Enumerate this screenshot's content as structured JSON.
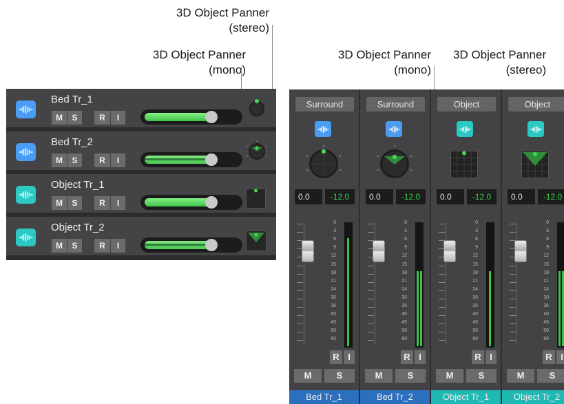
{
  "callouts": {
    "top_stereo": [
      "3D Object Panner",
      "(stereo)"
    ],
    "left_mono": [
      "3D Object Panner",
      "(mono)"
    ],
    "right_mono": [
      "3D Object Panner",
      "(mono)"
    ],
    "right_stereo": [
      "3D Object Panner",
      "(stereo)"
    ]
  },
  "colors": {
    "bed_icon": "#4a9cf5",
    "object_icon": "#2bc8c4",
    "meter_green": "#3ec24a",
    "value_green": "#39d34a",
    "strip_bg": "#434345",
    "bed_name_bg": "#2c6fbf",
    "object_name_bg": "#1fb8b3"
  },
  "tracks": [
    {
      "name": "Bed Tr_1",
      "kind": "bed",
      "icon": "waveform-icon",
      "buttons": [
        "M",
        "S",
        "R",
        "I"
      ],
      "panner": "surround-knob",
      "volume_level": 0.68
    },
    {
      "name": "Bed Tr_2",
      "kind": "bed",
      "icon": "waveform-icon",
      "buttons": [
        "M",
        "S",
        "R",
        "I"
      ],
      "panner": "surround-knob-stereo",
      "volume_level": 0.68
    },
    {
      "name": "Object Tr_1",
      "kind": "object",
      "icon": "waveform-icon",
      "buttons": [
        "M",
        "S",
        "R",
        "I"
      ],
      "panner": "object-panner-mono",
      "volume_level": 0.68
    },
    {
      "name": "Object Tr_2",
      "kind": "object",
      "icon": "waveform-icon",
      "buttons": [
        "M",
        "S",
        "R",
        "I"
      ],
      "panner": "object-panner-stereo",
      "volume_level": 0.68
    }
  ],
  "mixer": {
    "strips": [
      {
        "panner_type": "Surround",
        "pan": "0.0",
        "volume": "-12.0",
        "name": "Bed Tr_1",
        "kind": "bed",
        "meter_level": 0.89,
        "stereo_meter": false,
        "buttons": {
          "r": "R",
          "i": "I",
          "m": "M",
          "s": "S"
        }
      },
      {
        "panner_type": "Surround",
        "pan": "0.0",
        "volume": "-12.0",
        "name": "Bed Tr_2",
        "kind": "bed",
        "meter_level": 0.62,
        "stereo_meter": true,
        "buttons": {
          "r": "R",
          "i": "I",
          "m": "M",
          "s": "S"
        }
      },
      {
        "panner_type": "Object",
        "pan": "0.0",
        "volume": "-12.0",
        "name": "Object Tr_1",
        "kind": "object",
        "meter_level": 0.62,
        "stereo_meter": false,
        "buttons": {
          "r": "R",
          "i": "I",
          "m": "M",
          "s": "S"
        }
      },
      {
        "panner_type": "Object",
        "pan": "0.0",
        "volume": "-12.0",
        "name": "Object Tr_2",
        "kind": "object",
        "meter_level": 0.62,
        "stereo_meter": true,
        "buttons": {
          "r": "R",
          "i": "I",
          "m": "M",
          "s": "S"
        }
      }
    ],
    "scale_ticks": [
      "0",
      "3",
      "6",
      "9",
      "12",
      "15",
      "18",
      "21",
      "24",
      "30",
      "35",
      "40",
      "45",
      "50",
      "60"
    ]
  }
}
